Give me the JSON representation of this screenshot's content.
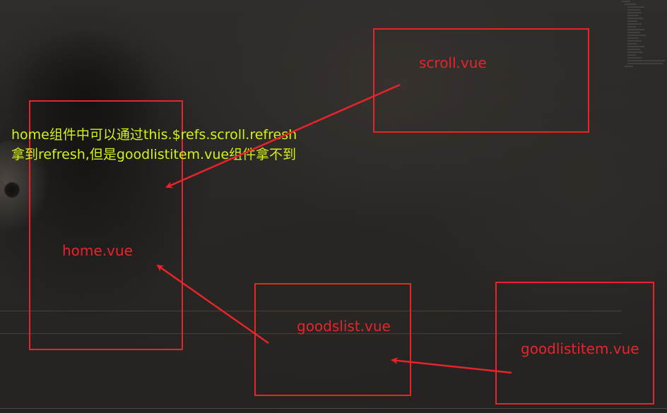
{
  "boxes": {
    "scroll": "scroll.vue",
    "home": "home.vue",
    "goodslist": "goodslist.vue",
    "goodlistitem": "goodlistitem.vue"
  },
  "note": {
    "line1": "home组件中可以通过this.$refs.scroll.refresh",
    "line2": "拿到refresh,但是goodlistitem.vue组件拿不到"
  },
  "colors": {
    "box_border": "#e8242b",
    "box_label": "#e8242b",
    "note_text": "#d4f21a",
    "arrow": "#e8242b"
  },
  "arrows": [
    {
      "from": "scroll.vue",
      "to": "home.vue"
    },
    {
      "from": "goodslist.vue",
      "to": "home.vue"
    },
    {
      "from": "goodlistitem.vue",
      "to": "goodslist.vue"
    }
  ]
}
